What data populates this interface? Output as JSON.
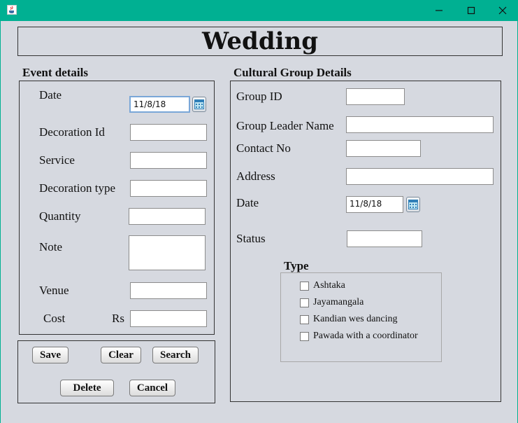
{
  "window": {
    "title_bar_color": "#00b092",
    "app_icon": "java-icon",
    "controls": [
      "minimize-icon",
      "maximize-icon",
      "close-icon"
    ]
  },
  "header": {
    "title": "Wedding"
  },
  "event": {
    "section_title": "Event details",
    "date_label": "Date",
    "date_value": "11/8/18",
    "decoration_id_label": "Decoration Id",
    "service_label": "Service",
    "decoration_type_label": "Decoration type",
    "quantity_label": "Quantity",
    "note_label": "Note",
    "venue_label": "Venue",
    "cost_label": "Cost",
    "cost_currency": "Rs"
  },
  "actions": {
    "save": "Save",
    "clear": "Clear",
    "search": "Search",
    "delete": "Delete",
    "cancel": "Cancel"
  },
  "cultural": {
    "section_title": "Cultural Group Details",
    "group_id_label": "Group ID",
    "leader_label": "Group Leader Name",
    "contact_label": "Contact No",
    "address_label": "Address",
    "date_label": "Date",
    "date_value": "11/8/18",
    "status_label": "Status",
    "type_title": "Type",
    "types": [
      "Ashtaka",
      "Jayamangala",
      "Kandian wes dancing",
      "Pawada with a coordinator"
    ]
  }
}
